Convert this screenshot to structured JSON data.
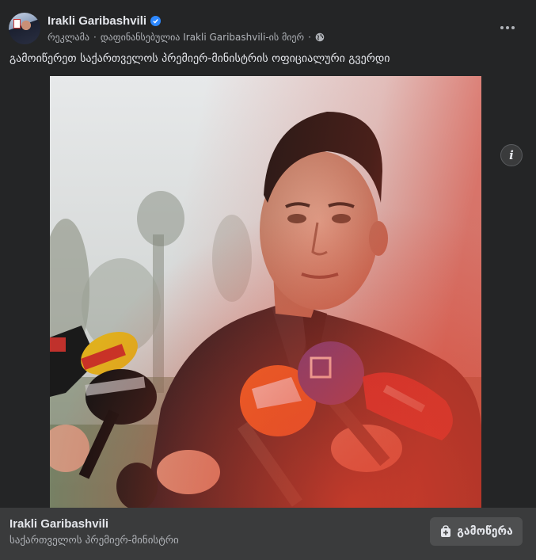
{
  "post": {
    "page_name": "Irakli Garibashvili",
    "sponsored_label": "რეკლამა",
    "separator": "·",
    "funded_by": "დაფინანსებულია Irakli Garibashvili-ის მიერ",
    "audience_icon": "globe-icon",
    "options_icon": "more-horizontal-icon",
    "text": "გამოიწერეთ საქართველოს პრემიერ-მინისტრის ოფიციალური გვერდი"
  },
  "media": {
    "info_label": "i",
    "colors": {
      "overlay_red": "#d43a2a",
      "mic_orange": "#f26b21",
      "mic_purple": "#4b3d9a"
    }
  },
  "footer": {
    "title": "Irakli Garibashvili",
    "subtitle": "საქართველოს პრემიერ-მინისტრი",
    "cta_label": "გამოწერა",
    "cta_icon": "subscribe-bag-icon"
  },
  "colors": {
    "card": "#242526",
    "footer": "#3a3b3c",
    "verified": "#2d88ff"
  }
}
